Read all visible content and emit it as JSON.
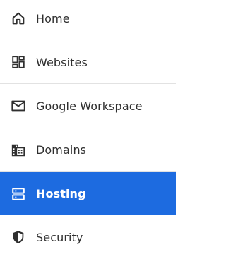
{
  "nav": {
    "items": [
      {
        "label": "Home",
        "icon": "home-icon",
        "active": false
      },
      {
        "label": "Websites",
        "icon": "dashboard-icon",
        "active": false
      },
      {
        "label": "Google Workspace",
        "icon": "mail-icon",
        "active": false
      },
      {
        "label": "Domains",
        "icon": "building-icon",
        "active": false
      },
      {
        "label": "Hosting",
        "icon": "server-icon",
        "active": true
      },
      {
        "label": "Security",
        "icon": "shield-icon",
        "active": false
      }
    ]
  },
  "colors": {
    "active_bg": "#1d6be0",
    "active_text": "#ffffff",
    "text": "#2f2f2f",
    "divider": "#e2e2e2"
  }
}
